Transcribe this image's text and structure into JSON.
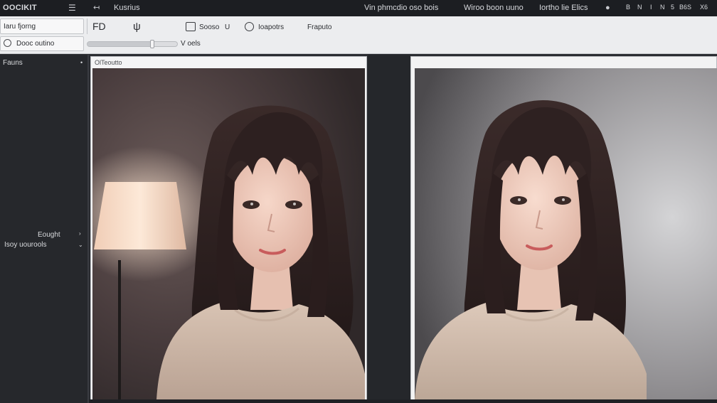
{
  "titlebar": {
    "app_name": "OOCIKIT",
    "menu_label": "Kusrius",
    "center_left": "Vin phmcdio oso bois",
    "center_right": "Wiroo boon uuno",
    "right_label": "Iortho lie Elics",
    "right_icons": [
      "B",
      "N",
      "I",
      "N",
      "5",
      "B6S",
      "X6"
    ]
  },
  "toolbar": {
    "field1_value": "Iaru fjorng",
    "field2_value": "Dooc outino",
    "tool1": "FD",
    "tool2_symbol": "ψ",
    "tool3_label": "Sooso",
    "tool3_suffix": "U",
    "tool4_label": "Ioapotrs",
    "tool5_label": "Fraputo",
    "slider_value_label": "V oels",
    "slider_level": 0.72
  },
  "sidebar": {
    "header": "Fauns",
    "item1": "Eought",
    "item2": "Isoy uourools"
  },
  "panel_left": {
    "header": "OlTeoutto"
  },
  "colors": {
    "accent": "#1c1e22",
    "toolbar_bg": "#ecedef",
    "sidebar_bg": "#26282c"
  }
}
